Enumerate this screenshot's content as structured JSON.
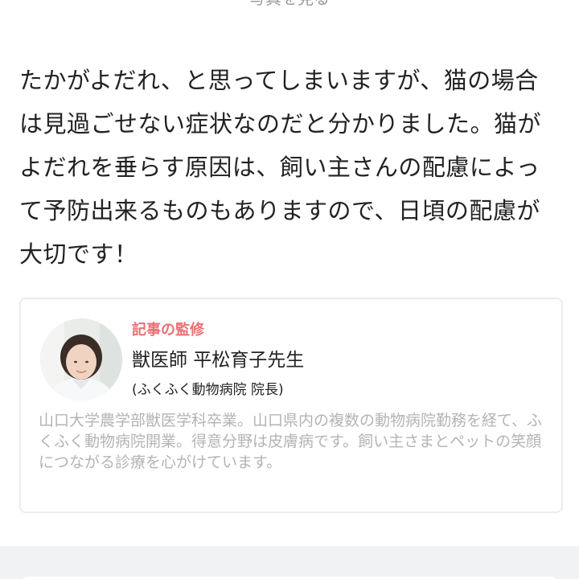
{
  "top_link": {
    "label": "写真を見る"
  },
  "article": {
    "paragraph": "たかがよだれ、と思ってしまいますが、猫の場合は見過ごせない症状なのだと分かりました。猫がよだれを垂らす原因は、飼い主さんの配慮によって予防出来るものもありますので、日頃の配慮が大切です！"
  },
  "supervisor": {
    "heading": "記事の監修",
    "name": "獣医師 平松育子先生",
    "clinic": "(ふくふく動物病院 院長)",
    "bio": "山口大学農学部獣医学科卒業。山口県内の複数の動物病院勤務を経て、ふくふく動物病院開業。得意分野は皮膚病です。飼い主さまとペットの笑顔につながる診療を心がけています。"
  },
  "colors": {
    "accent": "#ea6f73",
    "text": "#222222",
    "muted": "#b4b4b4",
    "card_border": "#ececec",
    "footer_background": "#f1f2f4"
  },
  "icons": {
    "avatar": "vet-portrait"
  }
}
